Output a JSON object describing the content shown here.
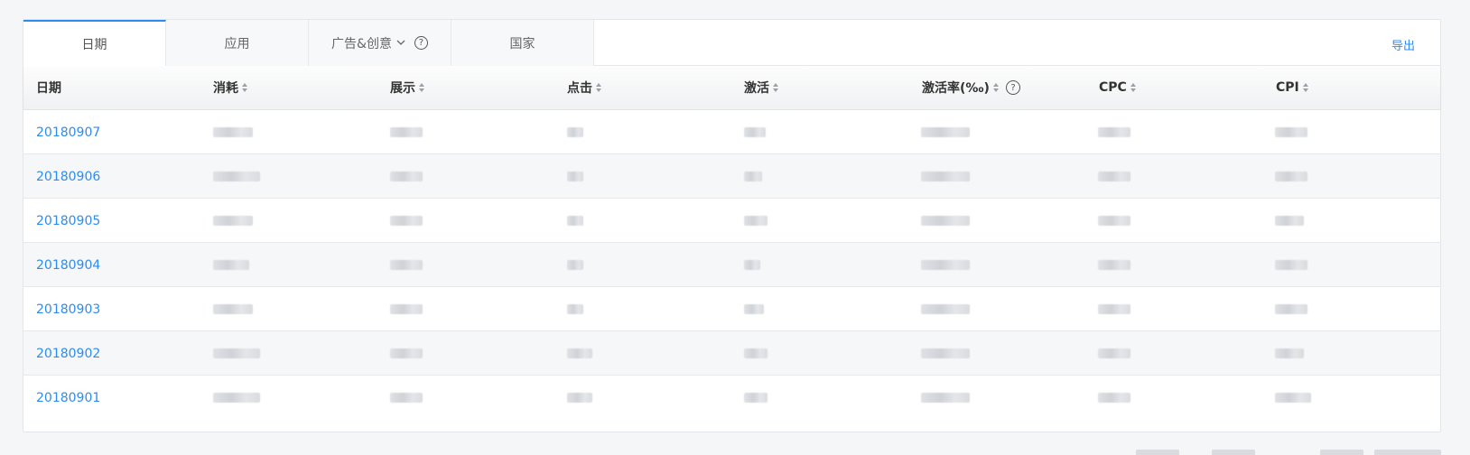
{
  "tabs": [
    {
      "label": "日期",
      "active": true
    },
    {
      "label": "应用",
      "active": false
    },
    {
      "label": "广告&创意",
      "active": false,
      "dropdown": true,
      "help": true
    },
    {
      "label": "国家",
      "active": false
    }
  ],
  "export_label": "导出",
  "help_glyph": "?",
  "columns": [
    {
      "label": "日期",
      "sortable": false
    },
    {
      "label": "消耗",
      "sortable": true
    },
    {
      "label": "展示",
      "sortable": true
    },
    {
      "label": "点击",
      "sortable": true
    },
    {
      "label": "激活",
      "sortable": true
    },
    {
      "label": "激活率(‰)",
      "sortable": true,
      "help": true
    },
    {
      "label": "CPC",
      "sortable": true
    },
    {
      "label": "CPI",
      "sortable": true
    }
  ],
  "rows": [
    {
      "date": "20180907"
    },
    {
      "date": "20180906"
    },
    {
      "date": "20180905"
    },
    {
      "date": "20180904"
    },
    {
      "date": "20180903"
    },
    {
      "date": "20180902"
    },
    {
      "date": "20180901"
    }
  ],
  "colors": {
    "accent": "#2d8cf0"
  }
}
